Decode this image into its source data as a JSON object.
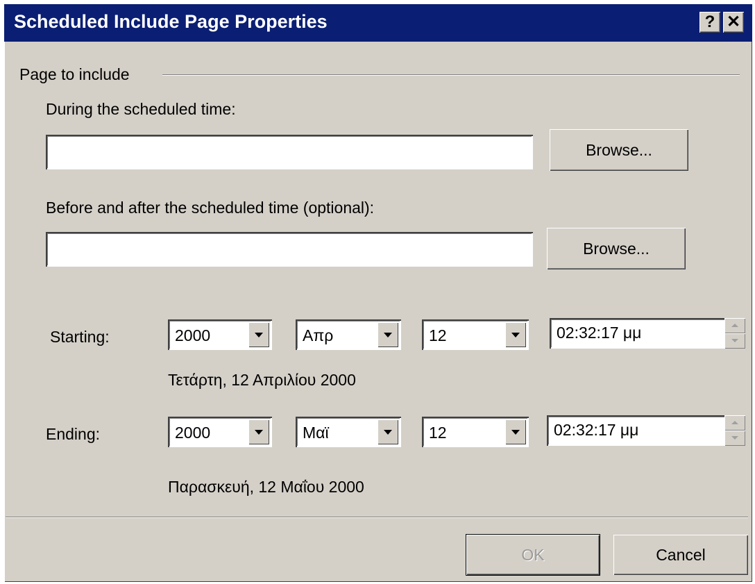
{
  "window": {
    "title": "Scheduled Include Page Properties",
    "help_label": "?",
    "close_label": "✕"
  },
  "group": {
    "label": "Page to include"
  },
  "during": {
    "label": "During the scheduled time:",
    "value": "",
    "browse_label": "Browse..."
  },
  "beforeafter": {
    "label": "Before and after the scheduled time (optional):",
    "value": "",
    "browse_label": "Browse..."
  },
  "starting": {
    "label": "Starting:",
    "year": "2000",
    "month": "Απρ",
    "day": "12",
    "time": "02:32:17 μμ",
    "date_text": "Τετάρτη, 12 Απριλίου 2000"
  },
  "ending": {
    "label": "Ending:",
    "year": "2000",
    "month": "Μαϊ",
    "day": "12",
    "time": "02:32:17 μμ",
    "date_text": "Παρασκευή, 12 Μαΐου 2000"
  },
  "buttons": {
    "ok_label": "OK",
    "cancel_label": "Cancel"
  },
  "colors": {
    "titlebar": "#0a1e73",
    "face": "#d4d0c8"
  }
}
